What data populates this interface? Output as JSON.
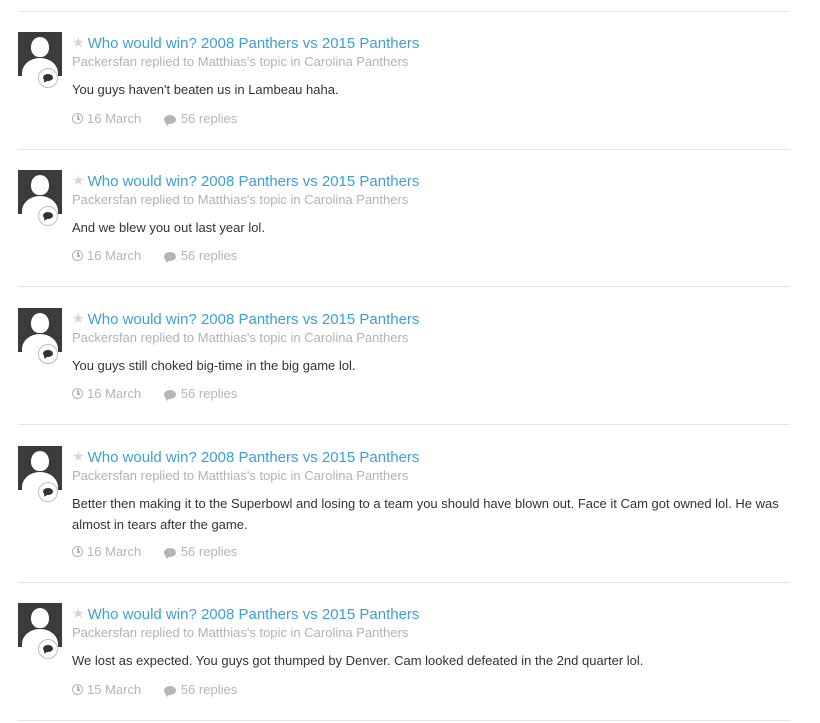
{
  "entries": [
    {
      "title": "Who would win? 2008 Panthers vs 2015 Panthers",
      "meta": "Packersfan replied to Matthias's topic in Carolina Panthers",
      "body": "You guys haven't beaten us in Lambeau haha.",
      "date": "16 March",
      "replies": "56 replies"
    },
    {
      "title": "Who would win? 2008 Panthers vs 2015 Panthers",
      "meta": "Packersfan replied to Matthias's topic in Carolina Panthers",
      "body": "And we blew you out last year lol.",
      "date": "16 March",
      "replies": "56 replies"
    },
    {
      "title": "Who would win? 2008 Panthers vs 2015 Panthers",
      "meta": "Packersfan replied to Matthias's topic in Carolina Panthers",
      "body": "You guys still choked big-time in the big game lol.",
      "date": "16 March",
      "replies": "56 replies"
    },
    {
      "title": "Who would win? 2008 Panthers vs 2015 Panthers",
      "meta": "Packersfan replied to Matthias's topic in Carolina Panthers",
      "body": "Better then making it to the Superbowl and losing to a team you should have blown out. Face it Cam got owned lol. He was almost in tears after the game.",
      "date": "16 March",
      "replies": "56 replies"
    },
    {
      "title": "Who would win? 2008 Panthers vs 2015 Panthers",
      "meta": "Packersfan replied to Matthias's topic in Carolina Panthers",
      "body": "We lost as expected. You guys got thumped by Denver. Cam looked defeated in the 2nd quarter lol.",
      "date": "15 March",
      "replies": "56 replies"
    }
  ],
  "icons": {
    "star": "star-icon",
    "clock": "clock-icon",
    "replies": "comment-icon",
    "badge": "speech-bubble-icon",
    "avatar": "default-user-avatar"
  },
  "colors": {
    "link": "#3d9fd4",
    "meta": "#b2b2b2",
    "divider": "#e5e5e5",
    "avatar_bg": "#3b3b3b"
  }
}
